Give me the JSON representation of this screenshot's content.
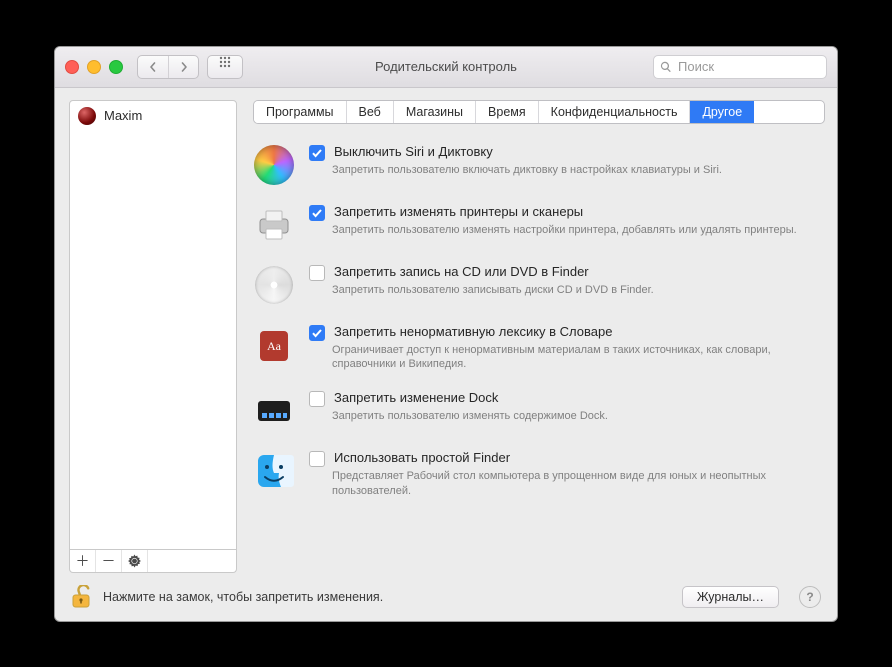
{
  "window": {
    "title": "Родительский контроль",
    "search_placeholder": "Поиск"
  },
  "sidebar": {
    "users": [
      {
        "name": "Maxim"
      }
    ],
    "add": "+",
    "remove": "−",
    "gear": "✱"
  },
  "tabs": [
    {
      "id": "apps",
      "label": "Программы",
      "active": false
    },
    {
      "id": "web",
      "label": "Веб",
      "active": false
    },
    {
      "id": "stores",
      "label": "Магазины",
      "active": false
    },
    {
      "id": "time",
      "label": "Время",
      "active": false
    },
    {
      "id": "privacy",
      "label": "Конфиденциальность",
      "active": false
    },
    {
      "id": "other",
      "label": "Другое",
      "active": true
    }
  ],
  "options": [
    {
      "id": "siri",
      "icon": "siri-icon",
      "checked": true,
      "label": "Выключить Siri и Диктовку",
      "desc": "Запретить пользователю включать диктовку в настройках клавиатуры и Siri."
    },
    {
      "id": "printer",
      "icon": "printer-icon",
      "checked": true,
      "label": "Запретить изменять принтеры и сканеры",
      "desc": "Запретить пользователю изменять настройки принтера, добавлять или удалять принтеры."
    },
    {
      "id": "disc",
      "icon": "disc-icon",
      "checked": false,
      "label": "Запретить запись на CD или DVD в Finder",
      "desc": "Запретить пользователю записывать диски CD и DVD в Finder."
    },
    {
      "id": "dictionary",
      "icon": "dictionary-icon",
      "checked": true,
      "label": "Запретить ненормативную лексику в Словаре",
      "desc": "Ограничивает доступ к ненормативным материалам в таких источниках, как словари, справочники и Википедия."
    },
    {
      "id": "dock",
      "icon": "dock-icon",
      "checked": false,
      "label": "Запретить изменение Dock",
      "desc": "Запретить пользователю изменять содержимое Dock."
    },
    {
      "id": "finder",
      "icon": "finder-icon",
      "checked": false,
      "label": "Использовать простой Finder",
      "desc": "Представляет Рабочий стол компьютера в упрощенном виде для юных и неопытных пользователей."
    }
  ],
  "footer": {
    "lock_text": "Нажмите на замок, чтобы запретить изменения.",
    "logs_button": "Журналы…",
    "help": "?"
  }
}
